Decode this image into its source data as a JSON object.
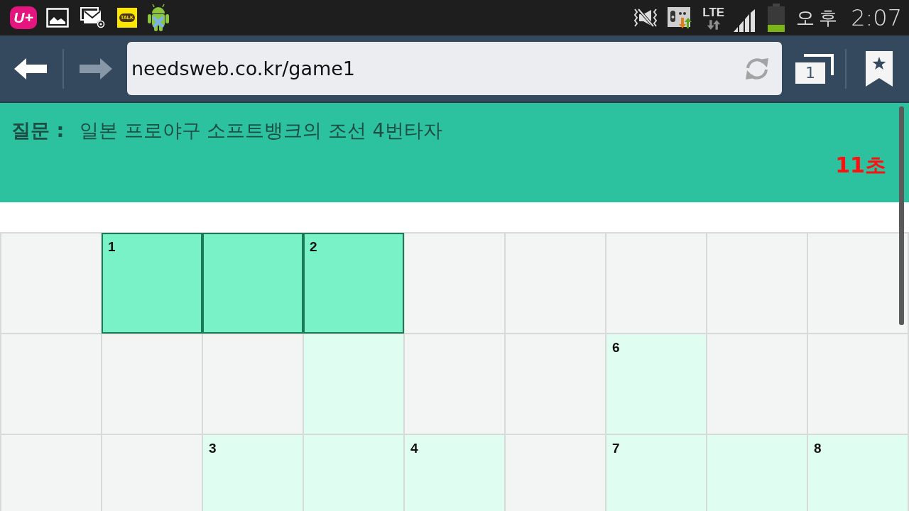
{
  "status_bar": {
    "notification_icons": [
      {
        "kind": "carrier",
        "label": "U+"
      },
      {
        "kind": "gallery"
      },
      {
        "kind": "email"
      },
      {
        "kind": "chat",
        "label": "TALK"
      },
      {
        "kind": "android"
      }
    ],
    "network": "LTE",
    "am_pm": "오후",
    "time": "2:07"
  },
  "browser": {
    "nav_buttons": [
      {
        "kind": "back",
        "disabled": false
      },
      {
        "kind": "forward",
        "disabled": true
      }
    ],
    "url": "needsweb.co.kr/game1",
    "tab_count": "1"
  },
  "question": {
    "label": "질문 :",
    "text": "일본 프로야구 소프트뱅크의 조선 4번타자",
    "timer": "11초"
  },
  "grid": {
    "rows": [
      [
        {
          "kind": "block",
          "highlighted": false
        },
        {
          "kind": "letter",
          "highlighted": true,
          "number": "1"
        },
        {
          "kind": "letter",
          "highlighted": true
        },
        {
          "kind": "letter",
          "highlighted": true,
          "number": "2"
        },
        {
          "kind": "block",
          "highlighted": false
        },
        {
          "kind": "block",
          "highlighted": false
        },
        {
          "kind": "block",
          "highlighted": false
        },
        {
          "kind": "block",
          "highlighted": false
        },
        {
          "kind": "block",
          "highlighted": false
        }
      ],
      [
        {
          "kind": "block",
          "highlighted": false
        },
        {
          "kind": "block",
          "highlighted": false
        },
        {
          "kind": "block",
          "highlighted": false
        },
        {
          "kind": "letter",
          "highlighted": false
        },
        {
          "kind": "block",
          "highlighted": false
        },
        {
          "kind": "block",
          "highlighted": false
        },
        {
          "kind": "letter",
          "highlighted": false,
          "number": "6"
        },
        {
          "kind": "block",
          "highlighted": false
        },
        {
          "kind": "block",
          "highlighted": false
        }
      ],
      [
        {
          "kind": "block",
          "highlighted": false
        },
        {
          "kind": "block",
          "highlighted": false
        },
        {
          "kind": "letter",
          "highlighted": false,
          "number": "3"
        },
        {
          "kind": "letter",
          "highlighted": false
        },
        {
          "kind": "letter",
          "highlighted": false,
          "number": "4"
        },
        {
          "kind": "block",
          "highlighted": false
        },
        {
          "kind": "letter",
          "highlighted": false,
          "number": "7"
        },
        {
          "kind": "letter",
          "highlighted": false
        },
        {
          "kind": "letter",
          "highlighted": false,
          "number": "8"
        }
      ]
    ]
  }
}
